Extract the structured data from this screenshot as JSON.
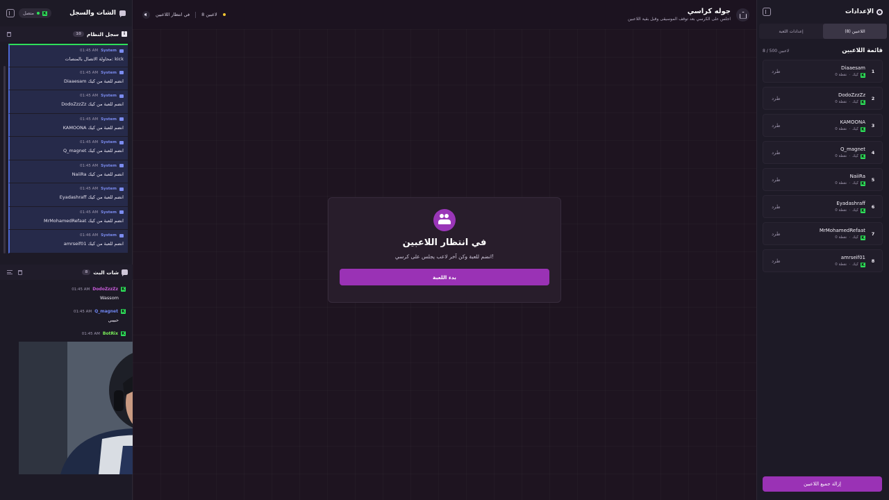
{
  "left_panel": {
    "title": "الشات والسجل",
    "status": "متصل",
    "system_log": {
      "title": "سجل النظام",
      "count": "10",
      "entries": [
        {
          "source": "System",
          "time": "01:45 AM",
          "text": "محاولة الاتصال بالمنصات: kick"
        },
        {
          "source": "System",
          "time": "01:45 AM",
          "text": "Diaaesam انضم للعبة من كيك"
        },
        {
          "source": "System",
          "time": "01:45 AM",
          "text": "DodoZzzZz انضم للعبة من كيك"
        },
        {
          "source": "System",
          "time": "01:45 AM",
          "text": "KAMOONA انضم للعبة من كيك"
        },
        {
          "source": "System",
          "time": "01:45 AM",
          "text": "Q_magnet انضم للعبة من كيك"
        },
        {
          "source": "System",
          "time": "01:45 AM",
          "text": "NaiiRa انضم للعبة من كيك"
        },
        {
          "source": "System",
          "time": "01:45 AM",
          "text": "Eyadashraff انضم للعبة من كيك"
        },
        {
          "source": "System",
          "time": "01:45 AM",
          "text": "MrMohamedRefaat انضم للعبة من كيك"
        },
        {
          "source": "System",
          "time": "01:46 AM",
          "text": "amrseif01 انضم للعبة من كيك"
        }
      ]
    },
    "live_chat": {
      "title": "شات البث",
      "count": "8",
      "messages": [
        {
          "user": "DodoZzzZz",
          "user_color": "#c65bd8",
          "time": "01:45 AM",
          "text": "Wassom"
        },
        {
          "user": "Q_magnet",
          "user_color": "#6f86f2",
          "time": "01:45 AM",
          "text": "حبيبي"
        },
        {
          "user": "BotRix",
          "user_color": "#7bf05a",
          "time": "01:45 AM",
          "text": ""
        }
      ]
    }
  },
  "topbar": {
    "game_title": "جوله كراسي",
    "game_subtitle": "اجلس على الكرسي بعد توقف الموسيقى وقبل بقية اللاعبين",
    "players_label": "8 لاعبين",
    "status": "في انتظار اللاعبين"
  },
  "center": {
    "title": "في انتظار اللاعبين",
    "subtitle": "انضم للعبة وكن آخر لاعب يجلس على كرسي!",
    "start_button": "بدء اللعبة"
  },
  "right_panel": {
    "title": "الإعدادات",
    "tabs": [
      "اللاعبين (8)",
      "إعدادات اللعبة"
    ],
    "players_title": "قائمة اللاعبين",
    "players_count": "8 / 500 لاعبين",
    "kick_label": "طرد",
    "platform": "كيك",
    "players": [
      {
        "num": "1",
        "name": "Diaaesam",
        "points": "0 نقطة"
      },
      {
        "num": "2",
        "name": "DodoZzzZz",
        "points": "0 نقطة"
      },
      {
        "num": "3",
        "name": "KAMOONA",
        "points": "0 نقطة"
      },
      {
        "num": "4",
        "name": "Q_magnet",
        "points": "0 نقطة"
      },
      {
        "num": "5",
        "name": "NaiiRa",
        "points": "0 نقطة"
      },
      {
        "num": "6",
        "name": "Eyadashraff",
        "points": "0 نقطة"
      },
      {
        "num": "7",
        "name": "MrMohamedRefaat",
        "points": "0 نقطة"
      },
      {
        "num": "8",
        "name": "amrseif01",
        "points": "0 نقطة"
      }
    ],
    "clear_button": "إزالة جميع اللاعبين"
  },
  "colors": {
    "accent": "#9a32b5",
    "kick_green": "#2ee05a",
    "system_blue": "#4e69d4",
    "waiting_yellow": "#f2c531"
  }
}
